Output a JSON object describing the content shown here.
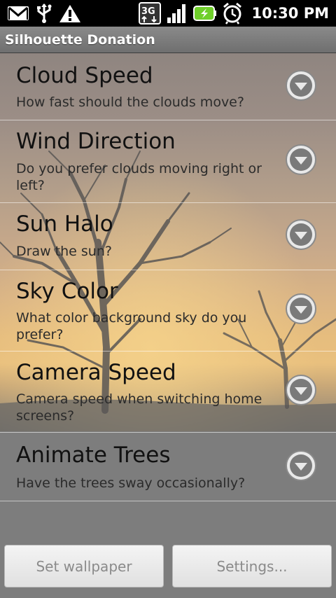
{
  "status_bar": {
    "time": "10:30 PM",
    "icons": [
      "gmail-icon",
      "usb-icon",
      "warning-icon",
      "3g-icon",
      "signal-icon",
      "battery-charging-icon",
      "alarm-icon"
    ],
    "network_label": "3G"
  },
  "title_bar": {
    "title": "Silhouette Donation"
  },
  "preferences": [
    {
      "title": "Cloud Speed",
      "summary": "How fast should the clouds move?"
    },
    {
      "title": "Wind Direction",
      "summary": "Do you prefer clouds moving right or left?"
    },
    {
      "title": "Sun Halo",
      "summary": "Draw the sun?"
    },
    {
      "title": "Sky Color",
      "summary": "What color background sky do you prefer?"
    },
    {
      "title": "Camera Speed",
      "summary": "Camera speed when switching home screens?"
    },
    {
      "title": "Animate Trees",
      "summary": "Have the trees sway occasionally?"
    }
  ],
  "buttons": {
    "set_wallpaper": "Set wallpaper",
    "settings": "Settings..."
  },
  "colors": {
    "status_bar_bg": "#000000",
    "title_bar_bg": "#7a7a7a",
    "button_text": "#8a8a8a",
    "sky_glow": "#e6bd7e"
  }
}
